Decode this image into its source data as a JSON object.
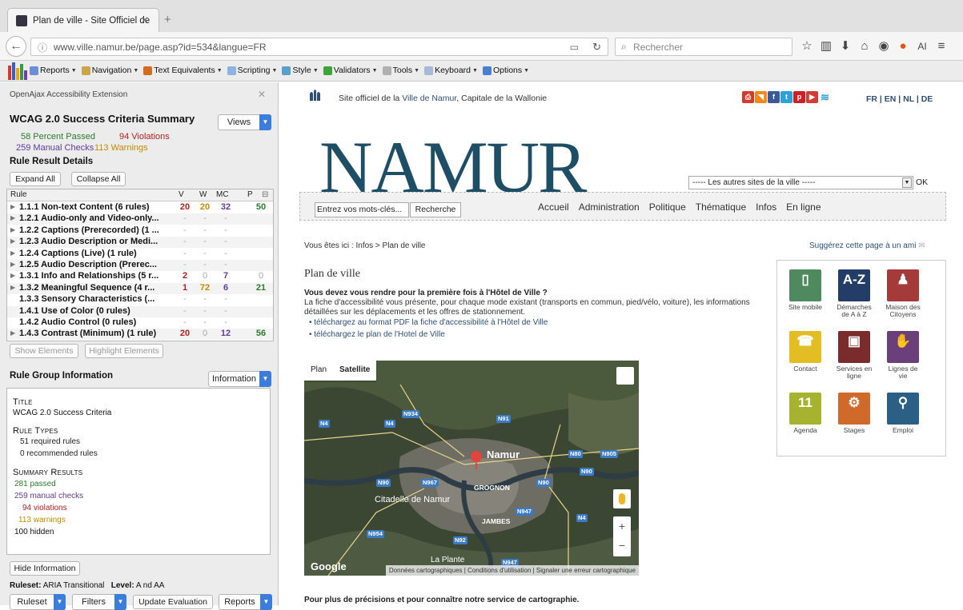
{
  "browser": {
    "tab_title": "Plan de ville - Site Officiel de",
    "url": "www.ville.namur.be/page.asp?id=534&langue=FR",
    "search_placeholder": "Rechercher",
    "user_initials": "AI"
  },
  "addon_toolbar": {
    "menus": [
      {
        "label": "Reports",
        "icon": "reports-icon",
        "color": "#6b8fd6"
      },
      {
        "label": "Navigation",
        "icon": "navigation-icon",
        "color": "#c9a64a"
      },
      {
        "label": "Text Equivalents",
        "icon": "text-equivalents-icon",
        "color": "#d26c1f"
      },
      {
        "label": "Scripting",
        "icon": "scripting-icon",
        "color": "#8fb3e0"
      },
      {
        "label": "Style",
        "icon": "style-icon",
        "color": "#5a9fc9"
      },
      {
        "label": "Validators",
        "icon": "validators-icon",
        "color": "#3da33d"
      },
      {
        "label": "Tools",
        "icon": "tools-icon",
        "color": "#b0b0b0"
      },
      {
        "label": "Keyboard",
        "icon": "keyboard-icon",
        "color": "#a9b8d6"
      },
      {
        "label": "Options",
        "icon": "options-icon",
        "color": "#4a7fd0"
      }
    ]
  },
  "sidebar": {
    "header": "OpenAjax Accessibility Extension",
    "summary_title": "WCAG 2.0 Success Criteria Summary",
    "views_label": "Views",
    "stats": {
      "percent_passed": "58 Percent Passed",
      "violations": "94 Violations",
      "manual_checks": "259 Manual Checks",
      "warnings": "113 Warnings"
    },
    "rule_result_details": "Rule Result Details",
    "expand_all": "Expand All",
    "collapse_all": "Collapse All",
    "table": {
      "headers": {
        "rule": "Rule",
        "v": "V",
        "w": "W",
        "mc": "MC",
        "p": "P"
      },
      "rows": [
        {
          "name": "1.1.1 Non-text Content (6 rules)",
          "v": "20",
          "w": "20",
          "mc": "32",
          "p": "50",
          "expander": true
        },
        {
          "name": "1.2.1 Audio-only and Video-only...",
          "v": "-",
          "w": "-",
          "mc": "-",
          "p": "",
          "expander": true
        },
        {
          "name": "1.2.2 Captions (Prerecorded) (1 ...",
          "v": "-",
          "w": "-",
          "mc": "-",
          "p": "",
          "expander": true
        },
        {
          "name": "1.2.3 Audio Description or Medi...",
          "v": "-",
          "w": "-",
          "mc": "-",
          "p": "",
          "expander": true
        },
        {
          "name": "1.2.4 Captions (Live) (1 rule)",
          "v": "-",
          "w": "-",
          "mc": "-",
          "p": "",
          "expander": true
        },
        {
          "name": "1.2.5 Audio Description (Prerec...",
          "v": "-",
          "w": "-",
          "mc": "-",
          "p": "",
          "expander": true
        },
        {
          "name": "1.3.1 Info and Relationships (5 r...",
          "v": "2",
          "w": "0",
          "mc": "7",
          "p": "0",
          "expander": true
        },
        {
          "name": "1.3.2 Meaningful Sequence (4 r...",
          "v": "1",
          "w": "72",
          "mc": "6",
          "p": "21",
          "expander": true
        },
        {
          "name": "1.3.3 Sensory Characteristics (...",
          "v": "-",
          "w": "-",
          "mc": "-",
          "p": "",
          "expander": false
        },
        {
          "name": "1.4.1 Use of Color (0 rules)",
          "v": "-",
          "w": "-",
          "mc": "-",
          "p": "",
          "expander": false
        },
        {
          "name": "1.4.2 Audio Control (0 rules)",
          "v": "-",
          "w": "-",
          "mc": "-",
          "p": "",
          "expander": false
        },
        {
          "name": "1.4.3 Contrast (Minimum) (1 rule)",
          "v": "20",
          "w": "0",
          "mc": "12",
          "p": "56",
          "expander": true
        }
      ]
    },
    "show_elements": "Show Elements",
    "highlight_elements": "Highlight Elements",
    "rule_group_info": "Rule Group Information",
    "information_label": "Information",
    "info": {
      "title_heading": "Title",
      "title_value": "WCAG 2.0 Success Criteria",
      "rule_types_heading": "Rule Types",
      "required": "51 required rules",
      "recommended": "0 recommended rules",
      "summary_heading": "Summary Results",
      "passed": "281 passed",
      "manual": "259 manual checks",
      "violations": "94 violations",
      "warnings": "113 warnings",
      "hidden": "100 hidden"
    },
    "hide_information": "Hide Information",
    "ruleset_label": "Ruleset:",
    "ruleset_value": "ARIA Transitional",
    "level_label": "Level:",
    "level_value": "A nd AA",
    "bottom_buttons": {
      "ruleset": "Ruleset",
      "filters": "Filters",
      "update": "Update Evaluation",
      "reports": "Reports"
    }
  },
  "page": {
    "site_prefix": "Site officiel de la ",
    "site_link": "Ville de Namur",
    "site_suffix": ", Capitale de la Wallonie",
    "languages": "FR | EN | NL | DE",
    "logo_text": "NAMUR",
    "other_sites": "----- Les autres sites de la ville -----",
    "ok": "OK",
    "search_value": "Entrez vos mots-clés...",
    "search_button": "Recherche",
    "nav": [
      "Accueil",
      "Administration",
      "Politique",
      "Thématique",
      "Infos",
      "En ligne"
    ],
    "breadcrumb": "Vous êtes ici : Infos > Plan de ville",
    "suggest": "Suggérez cette page à un ami",
    "title": "Plan de ville",
    "lead": "Vous devez vous rendre pour la première fois à l'Hôtel de Ville ?",
    "body": "La fiche d'accessibilité vous présente, pour chaque mode existant (transports en commun, pied/vélo, voiture), les informations détaillées sur les déplacements et les offres de stationnement.",
    "links": [
      "téléchargez au format PDF la fiche d'accessibilité à l'Hôtel de Ville",
      "téléchargez le plan de l'Hotel de Ville"
    ],
    "map": {
      "plan": "Plan",
      "satellite": "Satellite",
      "google": "Google",
      "footer": "Données cartographiques | Conditions d'utilisation | Signaler une erreur cartographique",
      "labels": {
        "namur": "Namur",
        "citadelle": "Citadelle de Namur",
        "grognon": "GROGNON",
        "jambes": "JAMBES",
        "la_plante": "La Plante"
      },
      "roads": [
        "N4",
        "N4",
        "N934",
        "N91",
        "N80",
        "N905",
        "N90",
        "N90",
        "N967",
        "N90",
        "N947",
        "N4",
        "N954",
        "N92",
        "N947"
      ]
    },
    "tiles": [
      {
        "label": "Site mobile",
        "color": "#4e8a5d",
        "glyph": "▯",
        "icon": "mobile-icon"
      },
      {
        "label": "Démarches de A à Z",
        "color": "#223e66",
        "glyph": "A-Z",
        "icon": "a-z-icon"
      },
      {
        "label": "Maison des Citoyens",
        "color": "#a53a3a",
        "glyph": "♟",
        "icon": "citizen-house-icon"
      },
      {
        "label": "Contact",
        "color": "#e3bd24",
        "glyph": "☎",
        "icon": "phone-icon"
      },
      {
        "label": "Services en ligne",
        "color": "#7a2c2c",
        "glyph": "▣",
        "icon": "online-services-icon"
      },
      {
        "label": "Lignes de vie",
        "color": "#6b3f7a",
        "glyph": "✋",
        "icon": "hand-icon"
      },
      {
        "label": "Agenda",
        "color": "#a6b330",
        "glyph": "11",
        "icon": "calendar-icon"
      },
      {
        "label": "Stages",
        "color": "#d06a2a",
        "glyph": "⚙",
        "icon": "stages-icon"
      },
      {
        "label": "Emploi",
        "color": "#2b5f84",
        "glyph": "⚲",
        "icon": "search-person-icon"
      }
    ],
    "footer_bold": "Pour plus de précisions et pour connaître notre service de cartographie."
  }
}
